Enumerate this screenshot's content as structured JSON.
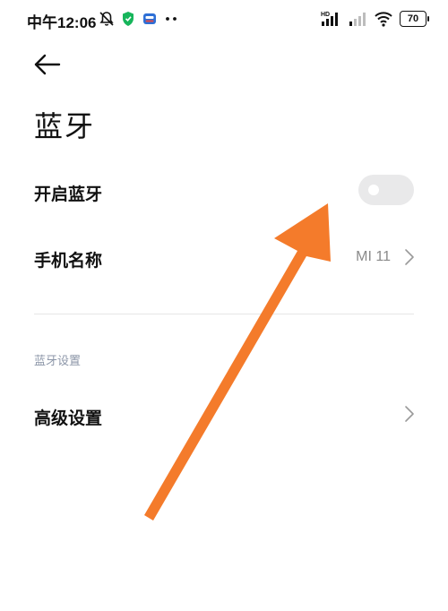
{
  "status_bar": {
    "time": "中午12:06",
    "battery": "70",
    "icons_left": [
      "alarm-off-icon",
      "shield-icon",
      "app-icon",
      "more-dots-icon"
    ],
    "icons_right": [
      "hd-signal-icon",
      "signal-icon",
      "wifi-icon",
      "battery-icon"
    ]
  },
  "header": {
    "title": "蓝牙",
    "back_icon": "back-arrow-icon"
  },
  "settings": {
    "bluetooth_toggle": {
      "label": "开启蓝牙",
      "state": "off"
    },
    "device_name": {
      "label": "手机名称",
      "value": "MI 11"
    },
    "section_label": "蓝牙设置",
    "advanced": {
      "label": "高级设置"
    }
  },
  "annotation": {
    "arrow_color": "#f47b2b",
    "points_to": "bluetooth_toggle"
  },
  "colors": {
    "accent_arrow": "#f47b2b",
    "toggle_off_track": "#e9e9ea",
    "secondary_text": "#8a8a8a",
    "section_header": "#8c96a8"
  }
}
